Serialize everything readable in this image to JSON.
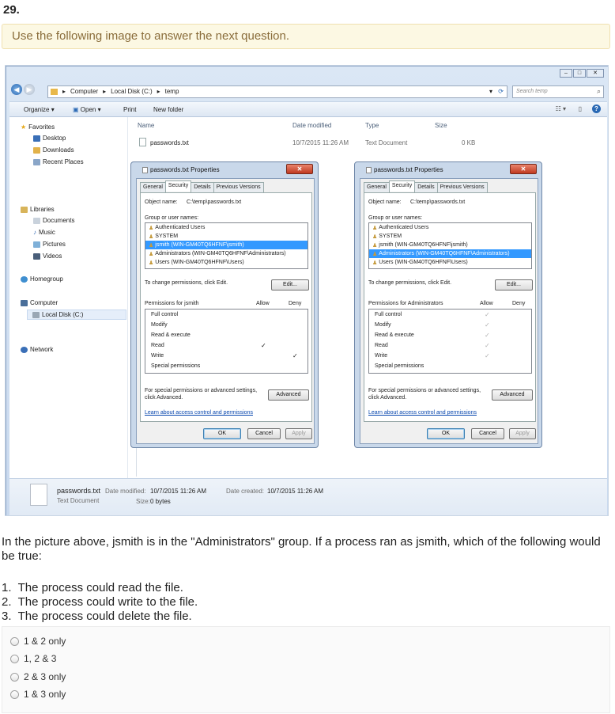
{
  "question_number": "29.",
  "hint": "Use the following image to answer the next question.",
  "explorer": {
    "breadcrumb": [
      "Computer",
      "Local Disk (C:)",
      "temp"
    ],
    "search_placeholder": "Search temp",
    "toolbar": {
      "organize": "Organize",
      "open": "Open",
      "print": "Print",
      "new_folder": "New folder"
    },
    "nav": {
      "favorites": "Favorites",
      "desktop": "Desktop",
      "downloads": "Downloads",
      "recent": "Recent Places",
      "libraries": "Libraries",
      "documents": "Documents",
      "music": "Music",
      "pictures": "Pictures",
      "videos": "Videos",
      "homegroup": "Homegroup",
      "computer": "Computer",
      "local_disk": "Local Disk (C:)",
      "network": "Network"
    },
    "columns": {
      "name": "Name",
      "date": "Date modified",
      "type": "Type",
      "size": "Size"
    },
    "file": {
      "name": "passwords.txt",
      "date": "10/7/2015 11:26 AM",
      "type": "Text Document",
      "size": "0 KB"
    },
    "details": {
      "name": "passwords.txt",
      "type": "Text Document",
      "date_modified_label": "Date modified:",
      "date_modified": "10/7/2015 11:26 AM",
      "size_label": "Size:",
      "size": "0 bytes",
      "date_created_label": "Date created:",
      "date_created": "10/7/2015 11:26 AM"
    }
  },
  "dialogs": [
    {
      "title": "passwords.txt Properties",
      "tabs": [
        "General",
        "Security",
        "Details",
        "Previous Versions"
      ],
      "object_label": "Object name:",
      "object_value": "C:\\temp\\passwords.txt",
      "group_label": "Group or user names:",
      "users": [
        "Authenticated Users",
        "SYSTEM",
        "jsmith (WIN-GM40TQ6HFNF\\jsmith)",
        "Administrators (WIN-GM40TQ6HFNF\\Administrators)",
        "Users (WIN-GM40TQ6HFNF\\Users)"
      ],
      "selected_index": 2,
      "change_text": "To change permissions, click Edit.",
      "edit": "Edit...",
      "perm_header": "Permissions for jsmith",
      "allow": "Allow",
      "deny": "Deny",
      "permissions": [
        {
          "name": "Full control",
          "allow": "",
          "deny": ""
        },
        {
          "name": "Modify",
          "allow": "",
          "deny": ""
        },
        {
          "name": "Read & execute",
          "allow": "",
          "deny": ""
        },
        {
          "name": "Read",
          "allow": "✓",
          "deny": ""
        },
        {
          "name": "Write",
          "allow": "",
          "deny": "✓"
        },
        {
          "name": "Special permissions",
          "allow": "",
          "deny": ""
        }
      ],
      "special_text_1": "For special permissions or advanced settings,",
      "special_text_2": "click Advanced.",
      "advanced": "Advanced",
      "learn": "Learn about access control and permissions",
      "ok": "OK",
      "cancel": "Cancel",
      "apply": "Apply"
    },
    {
      "title": "passwords.txt Properties",
      "tabs": [
        "General",
        "Security",
        "Details",
        "Previous Versions"
      ],
      "object_label": "Object name:",
      "object_value": "C:\\temp\\passwords.txt",
      "group_label": "Group or user names:",
      "users": [
        "Authenticated Users",
        "SYSTEM",
        "jsmith (WIN-GM40TQ6HFNF\\jsmith)",
        "Administrators (WIN-GM40TQ6HFNF\\Administrators)",
        "Users (WIN-GM40TQ6HFNF\\Users)"
      ],
      "selected_index": 3,
      "change_text": "To change permissions, click Edit.",
      "edit": "Edit...",
      "perm_header": "Permissions for Administrators",
      "allow": "Allow",
      "deny": "Deny",
      "permissions": [
        {
          "name": "Full control",
          "allow": "✓",
          "deny": ""
        },
        {
          "name": "Modify",
          "allow": "✓",
          "deny": ""
        },
        {
          "name": "Read & execute",
          "allow": "✓",
          "deny": ""
        },
        {
          "name": "Read",
          "allow": "✓",
          "deny": ""
        },
        {
          "name": "Write",
          "allow": "✓",
          "deny": ""
        },
        {
          "name": "Special permissions",
          "allow": "",
          "deny": ""
        }
      ],
      "special_text_1": "For special permissions or advanced settings,",
      "special_text_2": "click Advanced.",
      "advanced": "Advanced",
      "learn": "Learn about access control and permissions",
      "ok": "OK",
      "cancel": "Cancel",
      "apply": "Apply"
    }
  ],
  "question": "In the picture above, jsmith is in the \"Administrators\" group. If a process ran as jsmith, which of the following would be true:",
  "statements": [
    "The process could read the file.",
    "The process could write to the file.",
    "The process could delete the file."
  ],
  "answers": [
    "1 & 2 only",
    "1, 2 & 3",
    "2 & 3 only",
    "1 & 3 only"
  ]
}
